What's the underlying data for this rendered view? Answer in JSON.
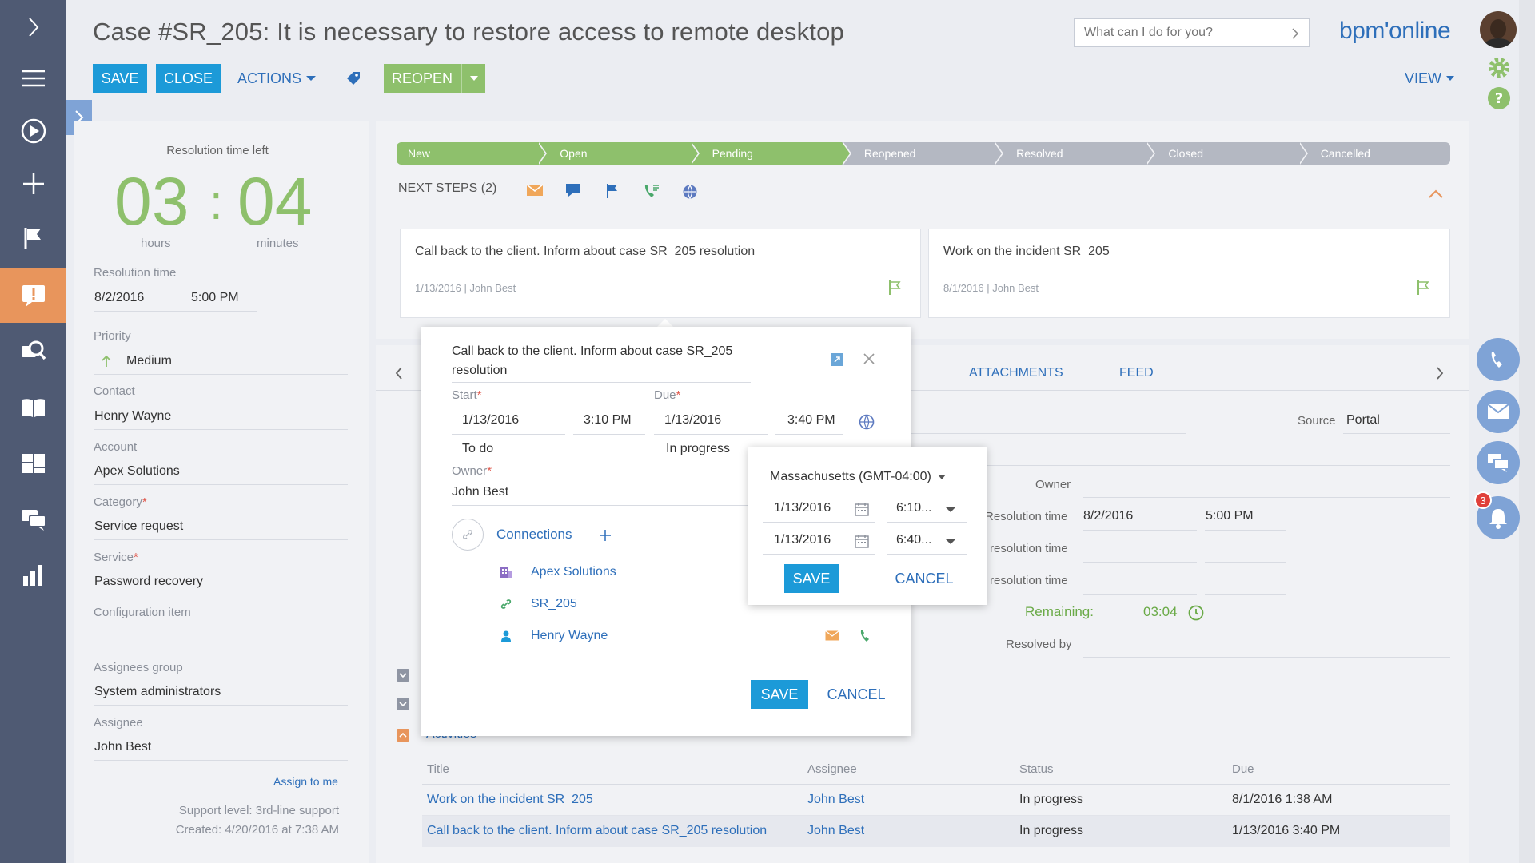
{
  "header": {
    "title": "Case #SR_205: It is necessary to restore access to remote desktop",
    "save": "SAVE",
    "close": "CLOSE",
    "actions": "ACTIONS",
    "reopen": "REOPEN",
    "view": "VIEW",
    "search_placeholder": "What can I do for you?",
    "logo": "bpm'online"
  },
  "left_panel": {
    "timer_caption": "Resolution time left",
    "hours": "03",
    "minutes": "04",
    "hours_label": "hours",
    "minutes_label": "minutes",
    "resolution_time_label": "Resolution time",
    "resolution_date": "8/2/2016",
    "resolution_time": "5:00 PM",
    "priority_label": "Priority",
    "priority": "Medium",
    "contact_label": "Contact",
    "contact": "Henry Wayne",
    "account_label": "Account",
    "account": "Apex Solutions",
    "category_label": "Category",
    "category": "Service request",
    "service_label": "Service",
    "service": "Password recovery",
    "config_label": "Configuration item",
    "group_label": "Assignees group",
    "group": "System administrators",
    "assignee_label": "Assignee",
    "assignee": "John Best",
    "assign_to_me": "Assign to me",
    "support_level": "Support level: 3rd-line support",
    "created": "Created: 4/20/2016 at 7:38 AM"
  },
  "stages": [
    {
      "label": "New",
      "done": true
    },
    {
      "label": "Open",
      "done": true
    },
    {
      "label": "Pending",
      "done": true
    },
    {
      "label": "Reopened",
      "done": false
    },
    {
      "label": "Resolved",
      "done": false
    },
    {
      "label": "Closed",
      "done": false
    },
    {
      "label": "Cancelled",
      "done": false
    }
  ],
  "next_steps": {
    "title": "NEXT STEPS (2)",
    "cards": [
      {
        "title": "Call back to the client. Inform about case SR_205 resolution",
        "date": "1/13/2016",
        "owner": "John Best"
      },
      {
        "title": "Work on the incident SR_205",
        "date": "8/1/2016",
        "owner": "John Best"
      }
    ]
  },
  "tabs": {
    "attachments": "ATTACHMENTS",
    "feed": "FEED"
  },
  "details": {
    "source_label": "Source",
    "source": "Portal",
    "owner_label": "Owner",
    "resolution_time_label": "Resolution time",
    "resolution_date": "8/2/2016",
    "resolution_time": "5:00 PM",
    "resolution_time_label2": "resolution time",
    "resolution_time_label3": "resolution time",
    "remaining_label": "Remaining:",
    "remaining": "03:04",
    "resolved_by_label": "Resolved by"
  },
  "activities": {
    "title": "Activities",
    "columns": [
      "Title",
      "Assignee",
      "Status",
      "Due"
    ],
    "rows": [
      {
        "title": "Work on the incident SR_205",
        "assignee": "John Best",
        "status": "In progress",
        "due": "8/1/2016 1:38 AM"
      },
      {
        "title": "Call back to the client. Inform about case SR_205 resolution",
        "assignee": "John Best",
        "status": "In progress",
        "due": "1/13/2016 3:40 PM"
      }
    ]
  },
  "modal": {
    "title": "Call back to the client. Inform about case SR_205 resolution",
    "start_label": "Start",
    "due_label": "Due",
    "start_date": "1/13/2016",
    "start_time": "3:10 PM",
    "due_date": "1/13/2016",
    "due_time": "3:40 PM",
    "status_left": "To do",
    "status_right": "In progress",
    "owner_label": "Owner",
    "owner": "John Best",
    "connections_label": "Connections",
    "connections": [
      {
        "label": "Apex Solutions",
        "icon": "building-icon"
      },
      {
        "label": "SR_205",
        "icon": "link-icon"
      },
      {
        "label": "Henry Wayne",
        "icon": "person-icon"
      }
    ],
    "save": "SAVE",
    "cancel": "CANCEL"
  },
  "tz_popup": {
    "timezone": "Massachusetts (GMT-04:00)",
    "start_date": "1/13/2016",
    "start_time": "6:10...",
    "end_date": "1/13/2016",
    "end_time": "6:40...",
    "save": "SAVE",
    "cancel": "CANCEL"
  },
  "notifications_count": "3",
  "colors": {
    "accent_blue": "#1c9ad8",
    "green": "#8ec06c",
    "nav": "#4f5a73",
    "nav_active": "#e8955c",
    "link": "#2e6fba"
  }
}
